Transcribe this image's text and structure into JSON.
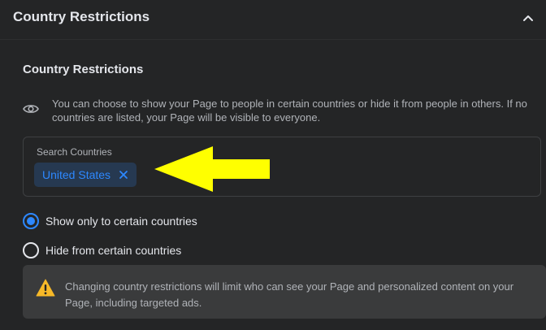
{
  "header": {
    "title": "Country Restrictions"
  },
  "section": {
    "title": "Country Restrictions",
    "description": "You can choose to show your Page to people in certain countries or hide it from people in others. If no countries are listed, your Page will be visible to everyone."
  },
  "search": {
    "label": "Search Countries",
    "chips": [
      {
        "label": "United States"
      }
    ]
  },
  "options": [
    {
      "label": "Show only to certain countries",
      "selected": true
    },
    {
      "label": "Hide from certain countries",
      "selected": false
    }
  ],
  "warning": {
    "text": "Changing country restrictions will limit who can see your Page and personalized content on your Page, including targeted ads."
  },
  "colors": {
    "background": "#242526",
    "accent": "#2d88ff",
    "chip_background": "#263951",
    "warning_background": "#3a3b3c",
    "warning_icon": "#f7b928",
    "annotation_arrow": "#ffff00"
  },
  "icons": {
    "collapse": "chevron-up-icon",
    "visibility": "eye-icon",
    "chip_remove": "close-icon",
    "warning": "warning-icon"
  }
}
